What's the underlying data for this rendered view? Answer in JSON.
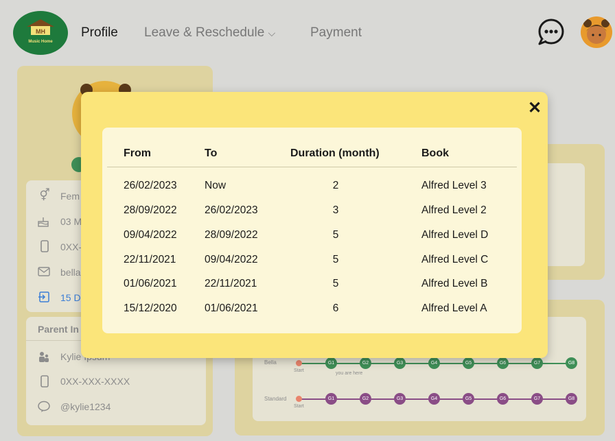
{
  "header": {
    "logo_text": "MH",
    "logo_subtext": "Music Home",
    "nav": [
      "Profile",
      "Leave & Reschedule",
      "Payment"
    ],
    "nav_dropdown_caret": "⌵"
  },
  "profile": {
    "gender": "Fem",
    "birthday": "03 M",
    "phone": "0XX-",
    "email": "bella",
    "joined": "15 D",
    "parent_heading": "Parent In",
    "parent_name": "Kylie Ipsum",
    "parent_phone": "0XX-XXX-XXXX",
    "parent_line": "@kylie1234"
  },
  "progress": {
    "rows": [
      {
        "label": "Bella",
        "start": "Start",
        "steps": [
          "G1",
          "G2",
          "G3",
          "G4",
          "G5",
          "G6",
          "G7",
          "G8"
        ],
        "note": "you are here"
      },
      {
        "label": "Standard",
        "start": "Start",
        "steps": [
          "G1",
          "G2",
          "G3",
          "G4",
          "G5",
          "G6",
          "G7",
          "G8"
        ]
      }
    ]
  },
  "modal": {
    "close_label": "✕",
    "columns": [
      "From",
      "To",
      "Duration (month)",
      "Book"
    ],
    "rows": [
      [
        "26/02/2023",
        "Now",
        "2",
        "Alfred Level 3"
      ],
      [
        "28/09/2022",
        "26/02/2023",
        "3",
        "Alfred Level 2"
      ],
      [
        "09/04/2022",
        "28/09/2022",
        "5",
        "Alfred Level D"
      ],
      [
        "22/11/2021",
        "09/04/2022",
        "5",
        "Alfred Level C"
      ],
      [
        "01/06/2021",
        "22/11/2021",
        "5",
        "Alfred Level B"
      ],
      [
        "15/12/2020",
        "01/06/2021",
        "6",
        "Alfred Level A"
      ]
    ]
  },
  "colors": {
    "modal_bg": "#fbe57a",
    "table_bg": "#fcf7d9",
    "progress_green": "#3f8f57",
    "progress_purple": "#8a4d86",
    "start_dot": "#e9846c"
  }
}
